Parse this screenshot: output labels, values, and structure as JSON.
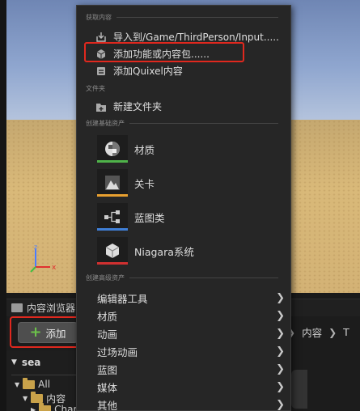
{
  "content_browser": {
    "tab_label": "内容浏览器",
    "add_label": "添加",
    "breadcrumbs": [
      "内容",
      "T"
    ],
    "tree_root": "sea",
    "tree_items": [
      "All",
      "内容",
      "Char"
    ]
  },
  "menu": {
    "sections": {
      "get_content": "获取内容",
      "folder": "文件夹",
      "create_basic": "创建基础资产",
      "create_advanced": "创建高级资产"
    },
    "get_content_items": [
      {
        "label": "导入到/Game/ThirdPerson/Input.....",
        "icon": "import-icon"
      },
      {
        "label": "添加功能或内容包......",
        "icon": "feature-pack-icon"
      },
      {
        "label": "添加Quixel内容",
        "icon": "quixel-icon"
      }
    ],
    "new_folder": "新建文件夹",
    "basic_assets": [
      {
        "label": "材质",
        "icon": "material-icon",
        "color": "#4fb34a"
      },
      {
        "label": "关卡",
        "icon": "level-icon",
        "color": "#e8a030"
      },
      {
        "label": "蓝图类",
        "icon": "blueprint-class-icon",
        "color": "#3f7fd6"
      },
      {
        "label": "Niagara系统",
        "icon": "niagara-icon",
        "color": "#d03030"
      }
    ],
    "advanced_items": [
      "编辑器工具",
      "材质",
      "动画",
      "过场动画",
      "蓝图",
      "媒体",
      "其他"
    ]
  },
  "colors": {
    "highlight": "#e0281e",
    "menu_bg": "#262626",
    "add_plus": "#6cc24a"
  }
}
